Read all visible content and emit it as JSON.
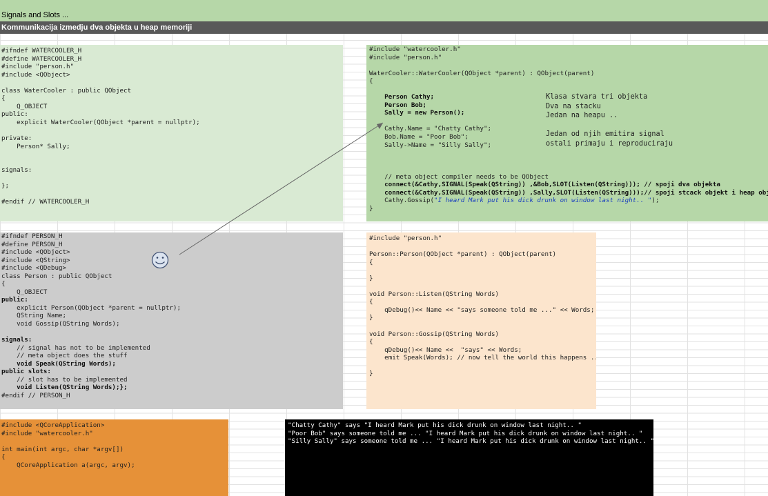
{
  "sheet": {
    "title": "Signals and Slots ...",
    "subtitle": "Kommunikacija izmedju dva objekta u heap memoriji"
  },
  "colors": {
    "title_band": "#b6d7a8",
    "subtitle_band": "#595959",
    "watercooler_header_bg": "#d9ead3",
    "watercooler_source_bg": "#b6d7a8",
    "person_header_bg": "#cccccc",
    "person_source_bg": "#fce5cd",
    "main_bg": "#e69138",
    "output_bg": "#000000",
    "string_literal": "#1a3fbf"
  },
  "watercooler_header": {
    "lines": [
      "#ifndef WATERCOOLER_H",
      "#define WATERCOOLER_H",
      "#include \"person.h\"",
      "#include <QObject>",
      "",
      "class WaterCooler : public QObject",
      "{",
      "    Q_OBJECT",
      "public:",
      "    explicit WaterCooler(QObject *parent = nullptr);",
      "",
      "private:",
      "    Person* Sally;",
      "",
      "",
      "signals:",
      "",
      "};",
      "",
      "#endif // WATERCOOLER_H"
    ]
  },
  "watercooler_source": {
    "lines": [
      "#include \"watercooler.h\"",
      "#include \"person.h\"",
      "",
      "WaterCooler::WaterCooler(QObject *parent) : QObject(parent)",
      "{",
      "",
      "    Person Cathy;",
      "    Person Bob;",
      "    Sally = new Person();",
      "",
      "    Cathy.Name = \"Chatty Cathy\";",
      "    Bob.Name = \"Poor Bob\";",
      "    Sally->Name = \"Silly Sally\";",
      "",
      "",
      "",
      "    // meta object compiler needs to be QObject",
      "    connect(&Cathy,SIGNAL(Speak(QString)) ,&Bob,SLOT(Listen(QString))); // spoji dva objekta",
      "    connect(&Cathy,SIGNAL(Speak(QString)) ,Sally,SLOT(Listen(QString)));// spoji stcack objekt i heap objekt",
      "    Cathy.Gossip(\"I heard Mark put his dick drunk on window last night.. \");",
      "}"
    ],
    "gossip_prefix": "    Cathy.Gossip(",
    "gossip_literal": "\"I heard Mark put his dick drunk on window last night.. \"",
    "gossip_suffix": ");"
  },
  "note": {
    "lines": [
      "Klasa stvara tri objekta",
      "Dva na stacku",
      "Jedan na heapu ..",
      "",
      "Jedan od njih emitira signal",
      "ostali primaju i reproduciraju"
    ]
  },
  "person_header": {
    "lines": [
      "#ifndef PERSON_H",
      "#define PERSON_H",
      "#include <QObject>",
      "#include <QString>",
      "#include <QDebug>",
      "class Person : public QObject",
      "{",
      "    Q_OBJECT",
      "public:",
      "    explicit Person(QObject *parent = nullptr);",
      "    QString Name;",
      "    void Gossip(QString Words);",
      "",
      "signals:",
      "    // signal has not to be implemented",
      "    // meta object does the stuff",
      "    void Speak(QString Words);",
      "public slots:",
      "    // slot has to be implemented",
      "    void Listen(QString Words);};",
      "#endif // PERSON_H"
    ]
  },
  "person_source": {
    "lines": [
      "#include \"person.h\"",
      "",
      "Person::Person(QObject *parent) : QObject(parent)",
      "{",
      "",
      "}",
      "",
      "void Person::Listen(QString Words)",
      "{",
      "    qDebug()<< Name << \"says someone told me ...\" << Words;",
      "}",
      "",
      "void Person::Gossip(QString Words)",
      "{",
      "    qDebug()<< Name <<  \"says\" << Words;",
      "    emit Speak(Words); // now tell the world this happens ..",
      "",
      "}"
    ]
  },
  "main_source": {
    "lines": [
      "#include <QCoreApplication>",
      "#include \"watercooler.h\"",
      "",
      "int main(int argc, char *argv[])",
      "{",
      "    QCoreApplication a(argc, argv);"
    ]
  },
  "console_output": {
    "lines": [
      "\"Chatty Cathy\" says \"I heard Mark put his dick drunk on window last night.. \"",
      "\"Poor Bob\" says someone told me ... \"I heard Mark put his dick drunk on window last night.. \"",
      "\"Silly Sally\" says someone told me ... \"I heard Mark put his dick drunk on window last night.. \""
    ]
  },
  "smiley": {
    "icon": "smiley-face-icon",
    "arrow_icon": "arrow-line-icon"
  }
}
